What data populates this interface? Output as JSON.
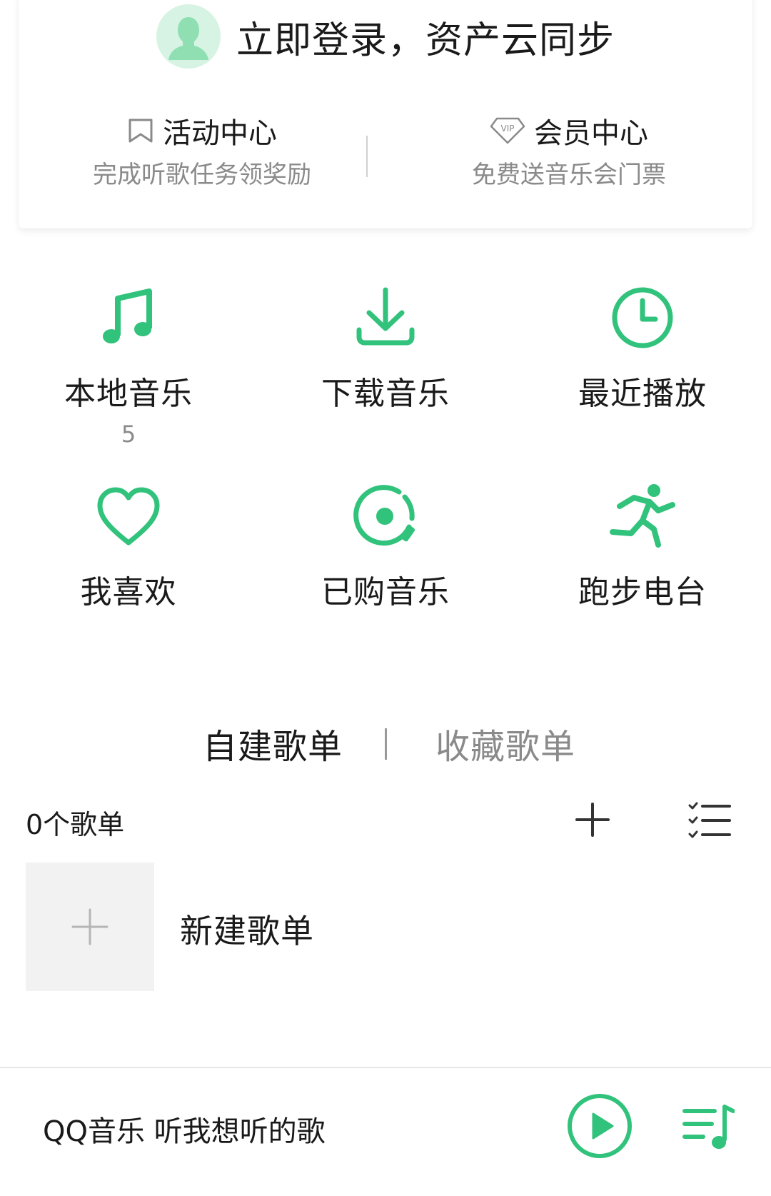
{
  "login": {
    "prompt": "立即登录，资产云同步",
    "avatar_icon": "user-avatar-icon"
  },
  "activity": {
    "title": "活动中心",
    "subtitle": "完成听歌任务领奖励",
    "icon": "bookmark-icon"
  },
  "vip": {
    "title": "会员中心",
    "subtitle": "免费送音乐会门票",
    "icon": "vip-badge-icon"
  },
  "grid": {
    "local_music": {
      "label": "本地音乐",
      "count": "5",
      "icon": "music-note-icon"
    },
    "downloads": {
      "label": "下载音乐",
      "icon": "download-icon"
    },
    "recent": {
      "label": "最近播放",
      "icon": "clock-icon"
    },
    "favorites": {
      "label": "我喜欢",
      "icon": "heart-icon"
    },
    "purchased": {
      "label": "已购音乐",
      "icon": "disc-icon"
    },
    "running": {
      "label": "跑步电台",
      "icon": "running-icon"
    }
  },
  "tabs": {
    "created": "自建歌单",
    "collected": "收藏歌单"
  },
  "playlists": {
    "count_label": "0个歌单",
    "new_label": "新建歌单"
  },
  "player": {
    "text": "QQ音乐 听我想听的歌",
    "play_icon": "play-icon",
    "queue_icon": "playlist-queue-icon"
  },
  "colors": {
    "accent": "#31c27c",
    "text": "#1a1a1a",
    "muted": "#8a8a8a",
    "avatar_bg": "#d6f3e3"
  }
}
